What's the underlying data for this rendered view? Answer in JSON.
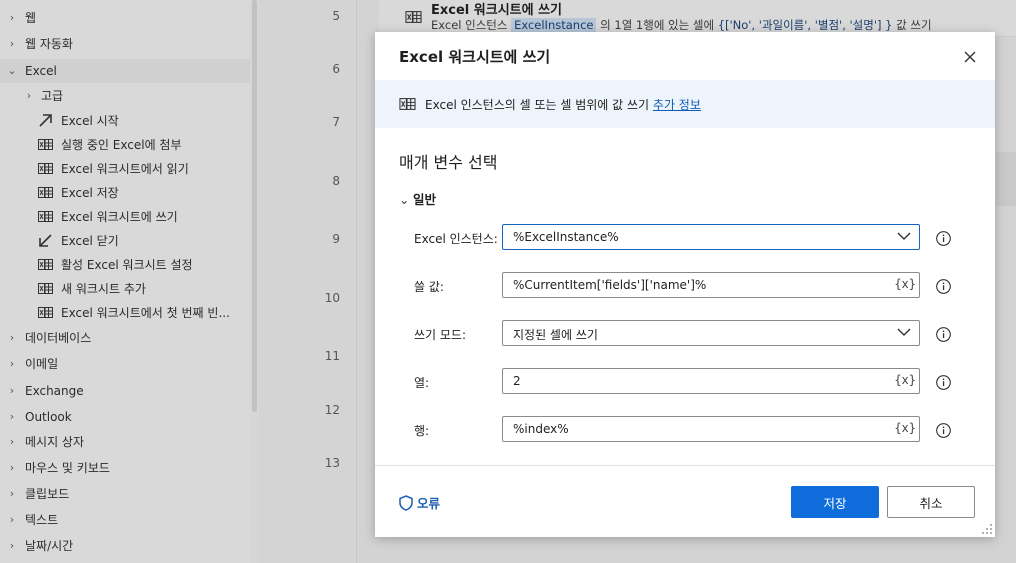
{
  "sidebar": {
    "groups": [
      {
        "label": "웹",
        "expanded": false
      },
      {
        "label": "웹 자동화",
        "expanded": false
      },
      {
        "label": "Excel",
        "expanded": true
      }
    ],
    "excel_subgroup": {
      "label": "고급",
      "expanded": false
    },
    "excel_actions": [
      {
        "label": "Excel 시작",
        "icon": "arrow-up-right-icon"
      },
      {
        "label": "실행 중인 Excel에 첨부",
        "icon": "excel-sheet-icon"
      },
      {
        "label": "Excel 워크시트에서 읽기",
        "icon": "excel-sheet-icon"
      },
      {
        "label": "Excel 저장",
        "icon": "excel-sheet-icon"
      },
      {
        "label": "Excel 워크시트에 쓰기",
        "icon": "excel-sheet-icon"
      },
      {
        "label": "Excel 닫기",
        "icon": "arrow-down-left-icon"
      },
      {
        "label": "활성 Excel 워크시트 설정",
        "icon": "excel-sheet-icon"
      },
      {
        "label": "새 워크시트 추가",
        "icon": "excel-sheet-icon"
      },
      {
        "label": "Excel 워크시트에서 첫 번째 빈...",
        "icon": "excel-sheet-icon"
      }
    ],
    "more_groups": [
      {
        "label": "데이터베이스"
      },
      {
        "label": "이메일"
      },
      {
        "label": "Exchange"
      },
      {
        "label": "Outlook"
      },
      {
        "label": "메시지 상자"
      },
      {
        "label": "마우스 및 키보드"
      },
      {
        "label": "클립보드"
      },
      {
        "label": "텍스트"
      },
      {
        "label": "날짜/시간"
      }
    ]
  },
  "editor": {
    "line_numbers": [
      "5",
      "6",
      "7",
      "8",
      "9",
      "10",
      "11",
      "12",
      "13"
    ],
    "step": {
      "title": "Excel 워크시트에 쓰기",
      "desc_prefix": "Excel 인스턴스 ",
      "instance_token": "ExcelInstance",
      "desc_middle": " 의 1열 1행에 있는 셀에 ",
      "desc_value": "{['No', '과일이름', '별점', '설명'] }",
      "desc_suffix": " 값 쓰기"
    }
  },
  "dialog": {
    "title": "Excel 워크시트에 쓰기",
    "info_text": "Excel 인스턴스의 셀 또는 셀 범위에 값 쓰기 ",
    "info_link": "추가 정보",
    "section_title": "매개 변수 선택",
    "group_label": "일반",
    "params": [
      {
        "label": "Excel 인스턴스:",
        "value": "%ExcelInstance%",
        "kind": "dropdown"
      },
      {
        "label": "쓸 값:",
        "value": "%CurrentItem['fields']['name']%",
        "kind": "text"
      },
      {
        "label": "쓰기 모드:",
        "value": "지정된 셀에 쓰기",
        "kind": "dropdown"
      },
      {
        "label": "열:",
        "value": "2",
        "kind": "text"
      },
      {
        "label": "행:",
        "value": "%index%",
        "kind": "text"
      }
    ],
    "var_button": "{x}",
    "error_label": "오류",
    "save_label": "저장",
    "cancel_label": "취소"
  },
  "colors": {
    "primary": "#0f6cdb",
    "link": "#0f5bb5",
    "info_band": "#eef4fb",
    "overlay_bg": "#d9d9d9"
  }
}
